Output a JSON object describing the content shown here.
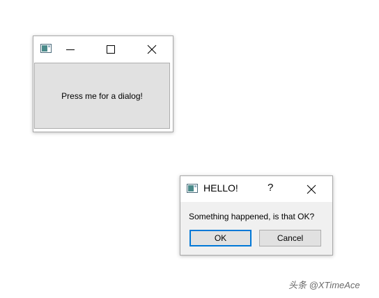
{
  "main_window": {
    "button_label": "Press me for a dialog!",
    "icons": {
      "app": "window-app-icon",
      "minimize": "minimize-icon",
      "maximize": "maximize-icon",
      "close": "close-icon"
    }
  },
  "dialog": {
    "title": "HELLO!",
    "help_label": "?",
    "message": "Something happened, is that OK?",
    "ok_label": "OK",
    "cancel_label": "Cancel"
  },
  "watermark": "头条 @XTimeAce",
  "colors": {
    "focus_border": "#0078d7",
    "button_face": "#e1e1e1",
    "dialog_background": "#f0f0f0"
  }
}
